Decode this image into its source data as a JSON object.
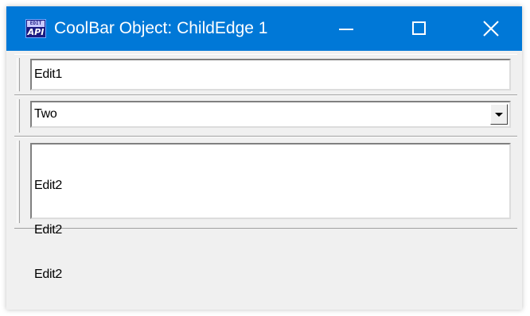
{
  "window": {
    "title": "CoolBar Object: ChildEdge 1",
    "icon": {
      "name": "app-icon",
      "top_text": "EDIT",
      "bottom_text": "API"
    },
    "buttons": {
      "minimize_icon": "minimize-icon",
      "maximize_icon": "maximize-icon",
      "close_icon": "close-icon"
    },
    "colors": {
      "titlebar": "#0078d7",
      "client": "#f0f0f0"
    }
  },
  "coolbar": {
    "bands": [
      {
        "type": "edit",
        "value": "Edit1"
      },
      {
        "type": "combobox",
        "value": "Two",
        "arrow_icon": "dropdown-arrow-icon"
      },
      {
        "type": "multiline-edit",
        "lines": [
          "Edit2",
          "Edit2",
          "Edit2"
        ]
      }
    ]
  }
}
